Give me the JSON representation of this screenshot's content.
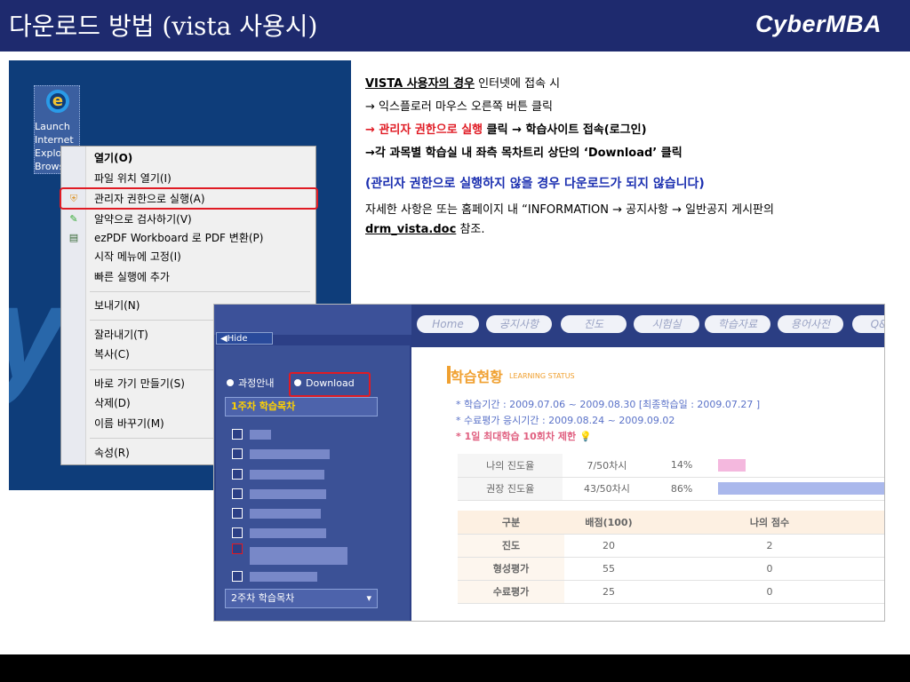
{
  "slide": {
    "title": "다운로드 방법 (vista 사용시)",
    "logo": "CyberMBA"
  },
  "desktop": {
    "icon_label": "Launch Internet Explorer Browser",
    "context_menu": [
      "열기(O)",
      "파일 위치 열기(I)",
      "관리자 권한으로 실행(A)",
      "알약으로 검사하기(V)",
      "ezPDF Workboard 로 PDF 변환(P)",
      "시작 메뉴에 고정(I)",
      "빠른 실행에 추가",
      "보내기(N)",
      "잘라내기(T)",
      "복사(C)",
      "바로 가기 만들기(S)",
      "삭제(D)",
      "이름 바꾸기(M)",
      "속성(R)"
    ]
  },
  "instructions": {
    "l1_bold": "VISTA 사용자의 경우",
    "l1_rest": " 인터넷에 접속 시",
    "l2": "→ 익스플로러 마우스 오른쪽 버튼 클릭",
    "l3_red": "→ 관리자 권한으로 실행",
    "l3_rest": " 클릭 → 학습사이트 접속(로그인)",
    "l4": "→각 과목별 학습실 내 좌측 목차트리 상단의  ‘Download’ 클릭",
    "warning": "(관리자 권한으로 실행하지 않을 경우 다운로드가 되지 않습니다)",
    "l6": "자세한 사항은 또는 홈페이지 내 “INFORMATION → 공지사항 → 일반공지 게시판의",
    "link": "drm_vista.doc",
    "l7_rest": " 참조."
  },
  "lms": {
    "hide": "Hide",
    "opt1": "과정안내",
    "opt2": "Download",
    "week1": "1주차 학습목차",
    "week2": "2주차 학습목차",
    "tabs": [
      "Home",
      "공지사항",
      "진도",
      "시험실",
      "학습자료",
      "용어사전",
      "Q&"
    ],
    "status_title": "학습현황",
    "status_sub": "LEARNING STATUS",
    "info1": "* 학습기간 : 2009.07.06 ~ 2009.08.30 [최종학습일 : 2009.07.27 ]",
    "info2": "* 수료평가 응시기간 : 2009.08.24 ~ 2009.09.02",
    "info3": "* 1일 최대학습 10회차 제한",
    "progress_rows": [
      {
        "label": "나의 진도율",
        "sessions": "7/50차시",
        "pct": "14%",
        "value": 14
      },
      {
        "label": "권장 진도율",
        "sessions": "43/50차시",
        "pct": "86%",
        "value": 86
      }
    ],
    "score_header": [
      "구분",
      "배점(100)",
      "나의 점수"
    ],
    "score_rows": [
      [
        "진도",
        "20",
        "2"
      ],
      [
        "형성평가",
        "55",
        "0"
      ],
      [
        "수료평가",
        "25",
        "0"
      ]
    ]
  },
  "colors": {
    "header": "#1e2a6e",
    "accent_red": "#e01b24",
    "warning_blue": "#1b2fb0"
  }
}
